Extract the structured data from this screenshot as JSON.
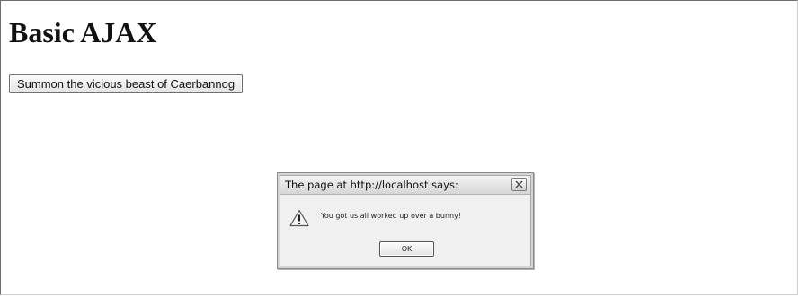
{
  "page": {
    "title": "Basic AJAX",
    "summon_button_label": "Summon the vicious beast of Caerbannog"
  },
  "dialog": {
    "title": "The page at http://localhost says:",
    "message": "You got us all worked up over a bunny!",
    "ok_label": "OK",
    "icon": "warning-icon",
    "close_icon": "close-icon"
  }
}
